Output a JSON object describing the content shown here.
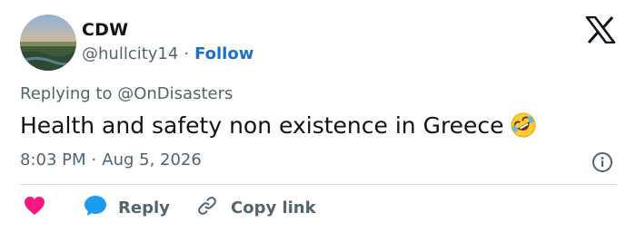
{
  "author": {
    "name": "CDW",
    "handle": "@hullcity14",
    "separator": "·",
    "follow_label": "Follow"
  },
  "reply_context": {
    "prefix": "Replying to",
    "mention": "@OnDisasters"
  },
  "tweet": {
    "text": "Health and safety non existence in Greece",
    "emoji": "rolling-on-floor-laughing"
  },
  "meta": {
    "time": "8:03 PM",
    "separator": "·",
    "date": "Aug 5, 2026"
  },
  "actions": {
    "like_icon": "heart-icon",
    "reply_label": "Reply",
    "copy_link_label": "Copy link"
  },
  "colors": {
    "text": "#0f1419",
    "secondary": "#536471",
    "follow": "#1d6fc9",
    "like": "#f91880",
    "reply": "#1d9bf0",
    "divider": "#cfd9de"
  }
}
